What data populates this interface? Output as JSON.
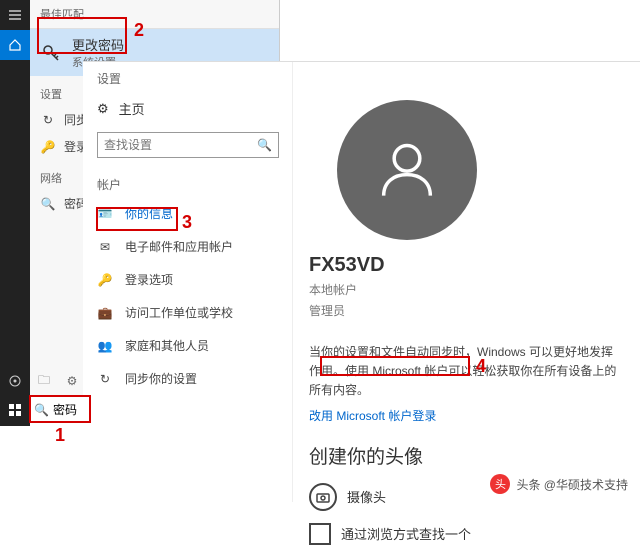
{
  "taskbar": {
    "search_value": "密码"
  },
  "cortana": {
    "header": "最佳匹配",
    "result": {
      "title": "更改密码",
      "subtitle": "系统设置"
    },
    "group_settings": "设置",
    "items_settings": [
      "同步你",
      "登录选"
    ],
    "group_web": "网络",
    "items_web": [
      "密码"
    ]
  },
  "settings": {
    "title": "设置",
    "home": "主页",
    "search_placeholder": "查找设置",
    "account_hdr": "帐户",
    "nav": {
      "info": "你的信息",
      "email": "电子邮件和应用帐户",
      "signin": "登录选项",
      "work": "访问工作单位或学校",
      "family": "家庭和其他人员",
      "sync": "同步你的设置"
    },
    "right": {
      "name": "FX53VD",
      "local": "本地帐户",
      "admin": "管理员",
      "desc": "当你的设置和文件自动同步时，Windows 可以更好地发挥作用。使用 Microsoft 帐户可以轻松获取你在所有设备上的所有内容。",
      "link": "改用 Microsoft 帐户登录",
      "create": "创建你的头像",
      "camera": "摄像头",
      "browse": "通过浏览方式查找一个"
    }
  },
  "annotations": {
    "n1": "1",
    "n2": "2",
    "n3": "3",
    "n4": "4"
  },
  "watermark": {
    "author": "头条 @华硕技术支持"
  }
}
